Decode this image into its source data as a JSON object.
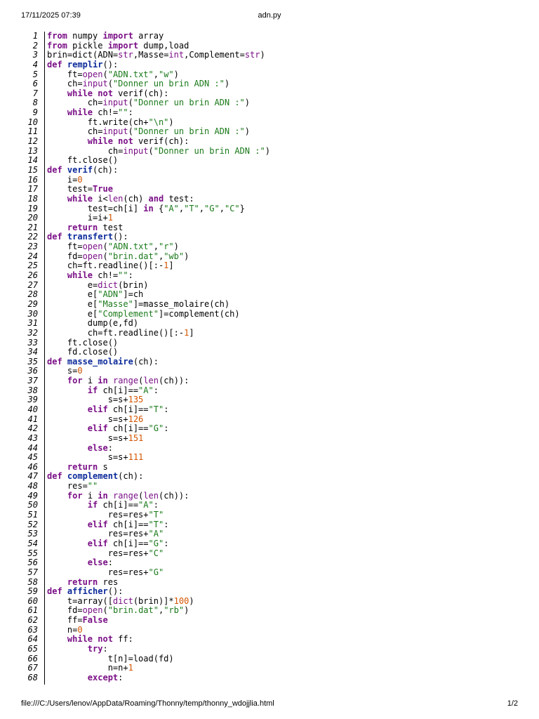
{
  "header": {
    "datetime": "17/11/2025 07:39",
    "title": "adn.py"
  },
  "footer": {
    "path": "file:///C:/Users/lenov/AppData/Roaming/Thonny/temp/thonny_wdojjlia.html",
    "page": "1/2"
  },
  "lines": [
    [
      [
        "k",
        "from"
      ],
      [
        "p",
        " numpy "
      ],
      [
        "k",
        "import"
      ],
      [
        "p",
        " array"
      ]
    ],
    [
      [
        "k",
        "from"
      ],
      [
        "p",
        " pickle "
      ],
      [
        "k",
        "import"
      ],
      [
        "p",
        " dump,load"
      ]
    ],
    [
      [
        "p",
        "brin=dict(ADN="
      ],
      [
        "b",
        "str"
      ],
      [
        "p",
        ",Masse="
      ],
      [
        "b",
        "int"
      ],
      [
        "p",
        ",Complement="
      ],
      [
        "b",
        "str"
      ],
      [
        "p",
        ")"
      ]
    ],
    [
      [
        "k",
        "def"
      ],
      [
        "p",
        " "
      ],
      [
        "f",
        "remplir"
      ],
      [
        "p",
        "():"
      ]
    ],
    [
      [
        "p",
        "    ft="
      ],
      [
        "b",
        "open"
      ],
      [
        "p",
        "("
      ],
      [
        "s",
        "\"ADN.txt\""
      ],
      [
        "p",
        ","
      ],
      [
        "s",
        "\"w\""
      ],
      [
        "p",
        ")"
      ]
    ],
    [
      [
        "p",
        "    ch="
      ],
      [
        "b",
        "input"
      ],
      [
        "p",
        "("
      ],
      [
        "s",
        "\"Donner un brin ADN :\""
      ],
      [
        "p",
        ")"
      ]
    ],
    [
      [
        "p",
        "    "
      ],
      [
        "k",
        "while not"
      ],
      [
        "p",
        " verif(ch):"
      ]
    ],
    [
      [
        "p",
        "        ch="
      ],
      [
        "b",
        "input"
      ],
      [
        "p",
        "("
      ],
      [
        "s",
        "\"Donner un brin ADN :\""
      ],
      [
        "p",
        ")"
      ]
    ],
    [
      [
        "p",
        "    "
      ],
      [
        "k",
        "while"
      ],
      [
        "p",
        " ch!="
      ],
      [
        "s",
        "\"\""
      ],
      [
        "p",
        ":"
      ]
    ],
    [
      [
        "p",
        "        ft.write(ch+"
      ],
      [
        "s",
        "\"\\n\""
      ],
      [
        "p",
        ")"
      ]
    ],
    [
      [
        "p",
        "        ch="
      ],
      [
        "b",
        "input"
      ],
      [
        "p",
        "("
      ],
      [
        "s",
        "\"Donner un brin ADN :\""
      ],
      [
        "p",
        ")"
      ]
    ],
    [
      [
        "p",
        "        "
      ],
      [
        "k",
        "while not"
      ],
      [
        "p",
        " verif(ch):"
      ]
    ],
    [
      [
        "p",
        "            ch="
      ],
      [
        "b",
        "input"
      ],
      [
        "p",
        "("
      ],
      [
        "s",
        "\"Donner un brin ADN :\""
      ],
      [
        "p",
        ")"
      ]
    ],
    [
      [
        "p",
        "    ft.close()"
      ]
    ],
    [
      [
        "k",
        "def"
      ],
      [
        "p",
        " "
      ],
      [
        "f",
        "verif"
      ],
      [
        "p",
        "(ch):"
      ]
    ],
    [
      [
        "p",
        "    i="
      ],
      [
        "n",
        "0"
      ]
    ],
    [
      [
        "p",
        "    test="
      ],
      [
        "k",
        "True"
      ]
    ],
    [
      [
        "p",
        "    "
      ],
      [
        "k",
        "while"
      ],
      [
        "p",
        " i<"
      ],
      [
        "b",
        "len"
      ],
      [
        "p",
        "(ch) "
      ],
      [
        "k",
        "and"
      ],
      [
        "p",
        " test:"
      ]
    ],
    [
      [
        "p",
        "        test=ch[i] "
      ],
      [
        "k",
        "in"
      ],
      [
        "p",
        " {"
      ],
      [
        "s",
        "\"A\""
      ],
      [
        "p",
        ","
      ],
      [
        "s",
        "\"T\""
      ],
      [
        "p",
        ","
      ],
      [
        "s",
        "\"G\""
      ],
      [
        "p",
        ","
      ],
      [
        "s",
        "\"C\""
      ],
      [
        "p",
        "}"
      ]
    ],
    [
      [
        "p",
        "        i=i+"
      ],
      [
        "n",
        "1"
      ]
    ],
    [
      [
        "p",
        "    "
      ],
      [
        "k",
        "return"
      ],
      [
        "p",
        " test"
      ]
    ],
    [
      [
        "k",
        "def"
      ],
      [
        "p",
        " "
      ],
      [
        "f",
        "transfert"
      ],
      [
        "p",
        "():"
      ]
    ],
    [
      [
        "p",
        "    ft="
      ],
      [
        "b",
        "open"
      ],
      [
        "p",
        "("
      ],
      [
        "s",
        "\"ADN.txt\""
      ],
      [
        "p",
        ","
      ],
      [
        "s",
        "\"r\""
      ],
      [
        "p",
        ")"
      ]
    ],
    [
      [
        "p",
        "    fd="
      ],
      [
        "b",
        "open"
      ],
      [
        "p",
        "("
      ],
      [
        "s",
        "\"brin.dat\""
      ],
      [
        "p",
        ","
      ],
      [
        "s",
        "\"wb\""
      ],
      [
        "p",
        ")"
      ]
    ],
    [
      [
        "p",
        "    ch=ft.readline()[:-"
      ],
      [
        "n",
        "1"
      ],
      [
        "p",
        "]"
      ]
    ],
    [
      [
        "p",
        "    "
      ],
      [
        "k",
        "while"
      ],
      [
        "p",
        " ch!="
      ],
      [
        "s",
        "\"\""
      ],
      [
        "p",
        ":"
      ]
    ],
    [
      [
        "p",
        "        e="
      ],
      [
        "b",
        "dict"
      ],
      [
        "p",
        "(brin)"
      ]
    ],
    [
      [
        "p",
        "        e["
      ],
      [
        "s",
        "\"ADN\""
      ],
      [
        "p",
        "]=ch"
      ]
    ],
    [
      [
        "p",
        "        e["
      ],
      [
        "s",
        "\"Masse\""
      ],
      [
        "p",
        "]=masse_molaire(ch)"
      ]
    ],
    [
      [
        "p",
        "        e["
      ],
      [
        "s",
        "\"Complement\""
      ],
      [
        "p",
        "]=complement(ch)"
      ]
    ],
    [
      [
        "p",
        "        dump(e,fd)"
      ]
    ],
    [
      [
        "p",
        "        ch=ft.readline()[:-"
      ],
      [
        "n",
        "1"
      ],
      [
        "p",
        "]"
      ]
    ],
    [
      [
        "p",
        "    ft.close()"
      ]
    ],
    [
      [
        "p",
        "    fd.close()"
      ]
    ],
    [
      [
        "k",
        "def"
      ],
      [
        "p",
        " "
      ],
      [
        "f",
        "masse_molaire"
      ],
      [
        "p",
        "(ch):"
      ]
    ],
    [
      [
        "p",
        "    s="
      ],
      [
        "n",
        "0"
      ]
    ],
    [
      [
        "p",
        "    "
      ],
      [
        "k",
        "for"
      ],
      [
        "p",
        " i "
      ],
      [
        "k",
        "in"
      ],
      [
        "p",
        " "
      ],
      [
        "b",
        "range"
      ],
      [
        "p",
        "("
      ],
      [
        "b",
        "len"
      ],
      [
        "p",
        "(ch)):"
      ]
    ],
    [
      [
        "p",
        "        "
      ],
      [
        "k",
        "if"
      ],
      [
        "p",
        " ch[i]=="
      ],
      [
        "s",
        "\"A\""
      ],
      [
        "p",
        ":"
      ]
    ],
    [
      [
        "p",
        "            s=s+"
      ],
      [
        "n",
        "135"
      ]
    ],
    [
      [
        "p",
        "        "
      ],
      [
        "k",
        "elif"
      ],
      [
        "p",
        " ch[i]=="
      ],
      [
        "s",
        "\"T\""
      ],
      [
        "p",
        ":"
      ]
    ],
    [
      [
        "p",
        "            s=s+"
      ],
      [
        "n",
        "126"
      ]
    ],
    [
      [
        "p",
        "        "
      ],
      [
        "k",
        "elif"
      ],
      [
        "p",
        " ch[i]=="
      ],
      [
        "s",
        "\"G\""
      ],
      [
        "p",
        ":"
      ]
    ],
    [
      [
        "p",
        "            s=s+"
      ],
      [
        "n",
        "151"
      ]
    ],
    [
      [
        "p",
        "        "
      ],
      [
        "k",
        "else"
      ],
      [
        "p",
        ":"
      ]
    ],
    [
      [
        "p",
        "            s=s+"
      ],
      [
        "n",
        "111"
      ]
    ],
    [
      [
        "p",
        "    "
      ],
      [
        "k",
        "return"
      ],
      [
        "p",
        " s"
      ]
    ],
    [
      [
        "k",
        "def"
      ],
      [
        "p",
        " "
      ],
      [
        "f",
        "complement"
      ],
      [
        "p",
        "(ch):"
      ]
    ],
    [
      [
        "p",
        "    res="
      ],
      [
        "s",
        "\"\""
      ]
    ],
    [
      [
        "p",
        "    "
      ],
      [
        "k",
        "for"
      ],
      [
        "p",
        " i "
      ],
      [
        "k",
        "in"
      ],
      [
        "p",
        " "
      ],
      [
        "b",
        "range"
      ],
      [
        "p",
        "("
      ],
      [
        "b",
        "len"
      ],
      [
        "p",
        "(ch)):"
      ]
    ],
    [
      [
        "p",
        "        "
      ],
      [
        "k",
        "if"
      ],
      [
        "p",
        " ch[i]=="
      ],
      [
        "s",
        "\"A\""
      ],
      [
        "p",
        ":"
      ]
    ],
    [
      [
        "p",
        "            res=res+"
      ],
      [
        "s",
        "\"T\""
      ]
    ],
    [
      [
        "p",
        "        "
      ],
      [
        "k",
        "elif"
      ],
      [
        "p",
        " ch[i]=="
      ],
      [
        "s",
        "\"T\""
      ],
      [
        "p",
        ":"
      ]
    ],
    [
      [
        "p",
        "            res=res+"
      ],
      [
        "s",
        "\"A\""
      ]
    ],
    [
      [
        "p",
        "        "
      ],
      [
        "k",
        "elif"
      ],
      [
        "p",
        " ch[i]=="
      ],
      [
        "s",
        "\"G\""
      ],
      [
        "p",
        ":"
      ]
    ],
    [
      [
        "p",
        "            res=res+"
      ],
      [
        "s",
        "\"C\""
      ]
    ],
    [
      [
        "p",
        "        "
      ],
      [
        "k",
        "else"
      ],
      [
        "p",
        ":"
      ]
    ],
    [
      [
        "p",
        "            res=res+"
      ],
      [
        "s",
        "\"G\""
      ]
    ],
    [
      [
        "p",
        "    "
      ],
      [
        "k",
        "return"
      ],
      [
        "p",
        " res"
      ]
    ],
    [
      [
        "k",
        "def"
      ],
      [
        "p",
        " "
      ],
      [
        "f",
        "afficher"
      ],
      [
        "p",
        "():"
      ]
    ],
    [
      [
        "p",
        "    t=array(["
      ],
      [
        "b",
        "dict"
      ],
      [
        "p",
        "(brin)]*"
      ],
      [
        "n",
        "100"
      ],
      [
        "p",
        ")"
      ]
    ],
    [
      [
        "p",
        "    fd="
      ],
      [
        "b",
        "open"
      ],
      [
        "p",
        "("
      ],
      [
        "s",
        "\"brin.dat\""
      ],
      [
        "p",
        ","
      ],
      [
        "s",
        "\"rb\""
      ],
      [
        "p",
        ")"
      ]
    ],
    [
      [
        "p",
        "    ff="
      ],
      [
        "k",
        "False"
      ]
    ],
    [
      [
        "p",
        "    n="
      ],
      [
        "n",
        "0"
      ]
    ],
    [
      [
        "p",
        "    "
      ],
      [
        "k",
        "while not"
      ],
      [
        "p",
        " ff:"
      ]
    ],
    [
      [
        "p",
        "        "
      ],
      [
        "k",
        "try"
      ],
      [
        "p",
        ":"
      ]
    ],
    [
      [
        "p",
        "            t[n]=load(fd)"
      ]
    ],
    [
      [
        "p",
        "            n=n+"
      ],
      [
        "n",
        "1"
      ]
    ],
    [
      [
        "p",
        "        "
      ],
      [
        "k",
        "except"
      ],
      [
        "p",
        ":"
      ]
    ]
  ]
}
